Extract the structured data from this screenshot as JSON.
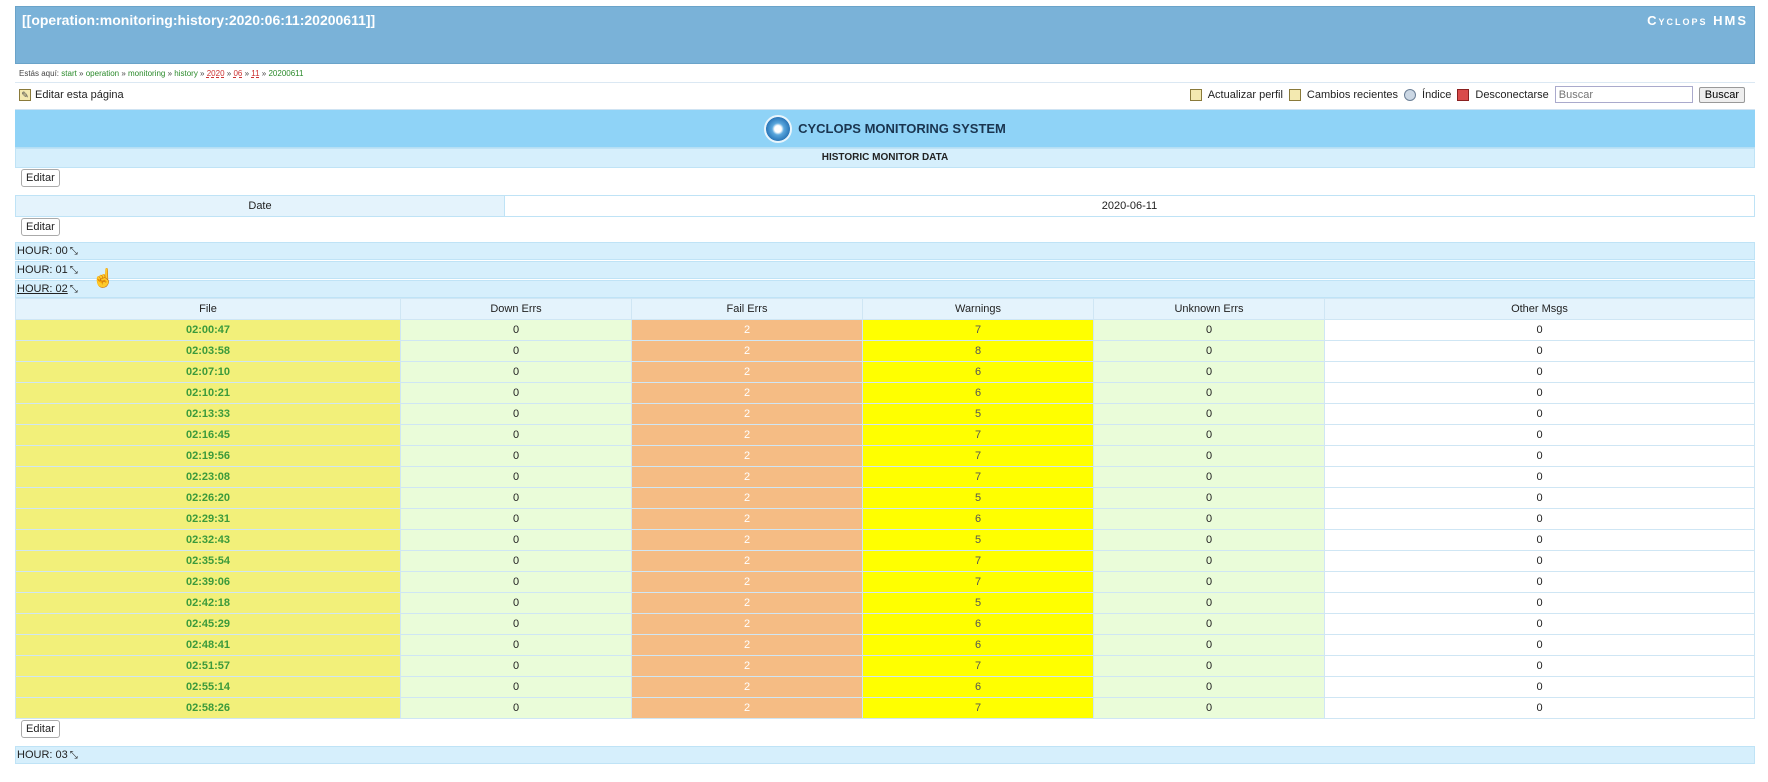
{
  "header": {
    "title": "[[operation:monitoring:history:2020:06:11:20200611]]",
    "brand": "Cyclops HMS"
  },
  "breadcrumb": {
    "prefix": "Estás aquí:",
    "items": [
      "start",
      "operation",
      "monitoring",
      "history",
      "2020",
      "06",
      "11",
      "20200611"
    ],
    "sep": "»"
  },
  "toolbar": {
    "edit_label": "Editar esta página",
    "update_profile": "Actualizar perfil",
    "recent_changes": "Cambios recientes",
    "index": "Índice",
    "logout": "Desconectarse",
    "search_placeholder": "Buscar",
    "search_button": "Buscar"
  },
  "banner": {
    "text": "CYCLOPS MONITORING SYSTEM"
  },
  "section": {
    "title": "HISTORIC MONITOR DATA",
    "edit": "Editar"
  },
  "info": {
    "date_label": "Date",
    "date_value": "2020-06-11"
  },
  "hours": [
    "HOUR: 00",
    "HOUR: 01",
    "HOUR: 02",
    "HOUR: 03"
  ],
  "table": {
    "headers": [
      "File",
      "Down Errs",
      "Fail Errs",
      "Warnings",
      "Unknown Errs",
      "Other Msgs"
    ],
    "rows": [
      [
        "02:00:47",
        "0",
        "2",
        "7",
        "0",
        "0"
      ],
      [
        "02:03:58",
        "0",
        "2",
        "8",
        "0",
        "0"
      ],
      [
        "02:07:10",
        "0",
        "2",
        "6",
        "0",
        "0"
      ],
      [
        "02:10:21",
        "0",
        "2",
        "6",
        "0",
        "0"
      ],
      [
        "02:13:33",
        "0",
        "2",
        "5",
        "0",
        "0"
      ],
      [
        "02:16:45",
        "0",
        "2",
        "7",
        "0",
        "0"
      ],
      [
        "02:19:56",
        "0",
        "2",
        "7",
        "0",
        "0"
      ],
      [
        "02:23:08",
        "0",
        "2",
        "7",
        "0",
        "0"
      ],
      [
        "02:26:20",
        "0",
        "2",
        "5",
        "0",
        "0"
      ],
      [
        "02:29:31",
        "0",
        "2",
        "6",
        "0",
        "0"
      ],
      [
        "02:32:43",
        "0",
        "2",
        "5",
        "0",
        "0"
      ],
      [
        "02:35:54",
        "0",
        "2",
        "7",
        "0",
        "0"
      ],
      [
        "02:39:06",
        "0",
        "2",
        "7",
        "0",
        "0"
      ],
      [
        "02:42:18",
        "0",
        "2",
        "5",
        "0",
        "0"
      ],
      [
        "02:45:29",
        "0",
        "2",
        "6",
        "0",
        "0"
      ],
      [
        "02:48:41",
        "0",
        "2",
        "6",
        "0",
        "0"
      ],
      [
        "02:51:57",
        "0",
        "2",
        "7",
        "0",
        "0"
      ],
      [
        "02:55:14",
        "0",
        "2",
        "6",
        "0",
        "0"
      ],
      [
        "02:58:26",
        "0",
        "2",
        "7",
        "0",
        "0"
      ]
    ]
  },
  "colors": {
    "header": "#7ab2d8",
    "banner": "#8fd3f7",
    "file": "#f2f07a",
    "fail": "#f5bc84",
    "warn": "#ffff00",
    "ok": "#eafcd9"
  }
}
